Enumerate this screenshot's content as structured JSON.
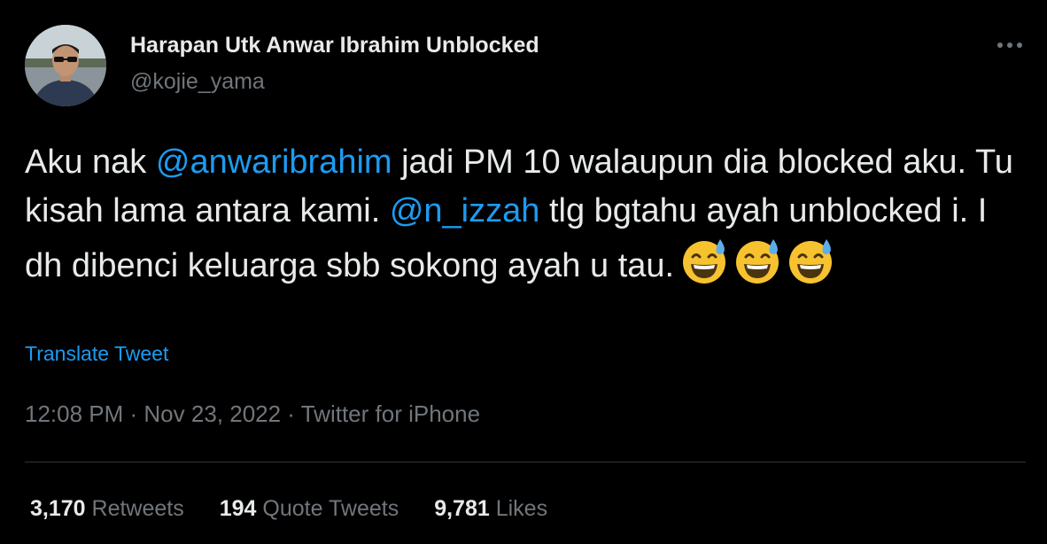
{
  "author": {
    "name": "Harapan Utk Anwar Ibrahim Unblocked",
    "handle": "@kojie_yama"
  },
  "tweet": {
    "text_1": "Aku nak ",
    "mention_1": "@anwaribrahim",
    "text_2": " jadi PM 10 walaupun dia blocked aku. Tu kisah lama antara kami. ",
    "mention_2": "@n_izzah",
    "text_3": " tlg bgtahu ayah unblocked i. I dh dibenci keluarga sbb sokong ayah u tau.",
    "emojis": [
      "grinning-face-with-sweat",
      "grinning-face-with-sweat",
      "grinning-face-with-sweat"
    ]
  },
  "translate_label": "Translate Tweet",
  "meta": {
    "time": "12:08 PM",
    "sep_1": " · ",
    "date": "Nov 23, 2022",
    "sep_2": " · ",
    "source": "Twitter for iPhone"
  },
  "stats": {
    "retweets_count": "3,170",
    "retweets_label": "Retweets",
    "quotes_count": "194",
    "quotes_label": "Quote Tweets",
    "likes_count": "9,781",
    "likes_label": "Likes"
  },
  "colors": {
    "background": "#000000",
    "text": "#e7e9ea",
    "secondary": "#71767b",
    "accent": "#1d9bf0",
    "divider": "#2f3336"
  },
  "icons": {
    "more": "more-horizontal-icon"
  }
}
